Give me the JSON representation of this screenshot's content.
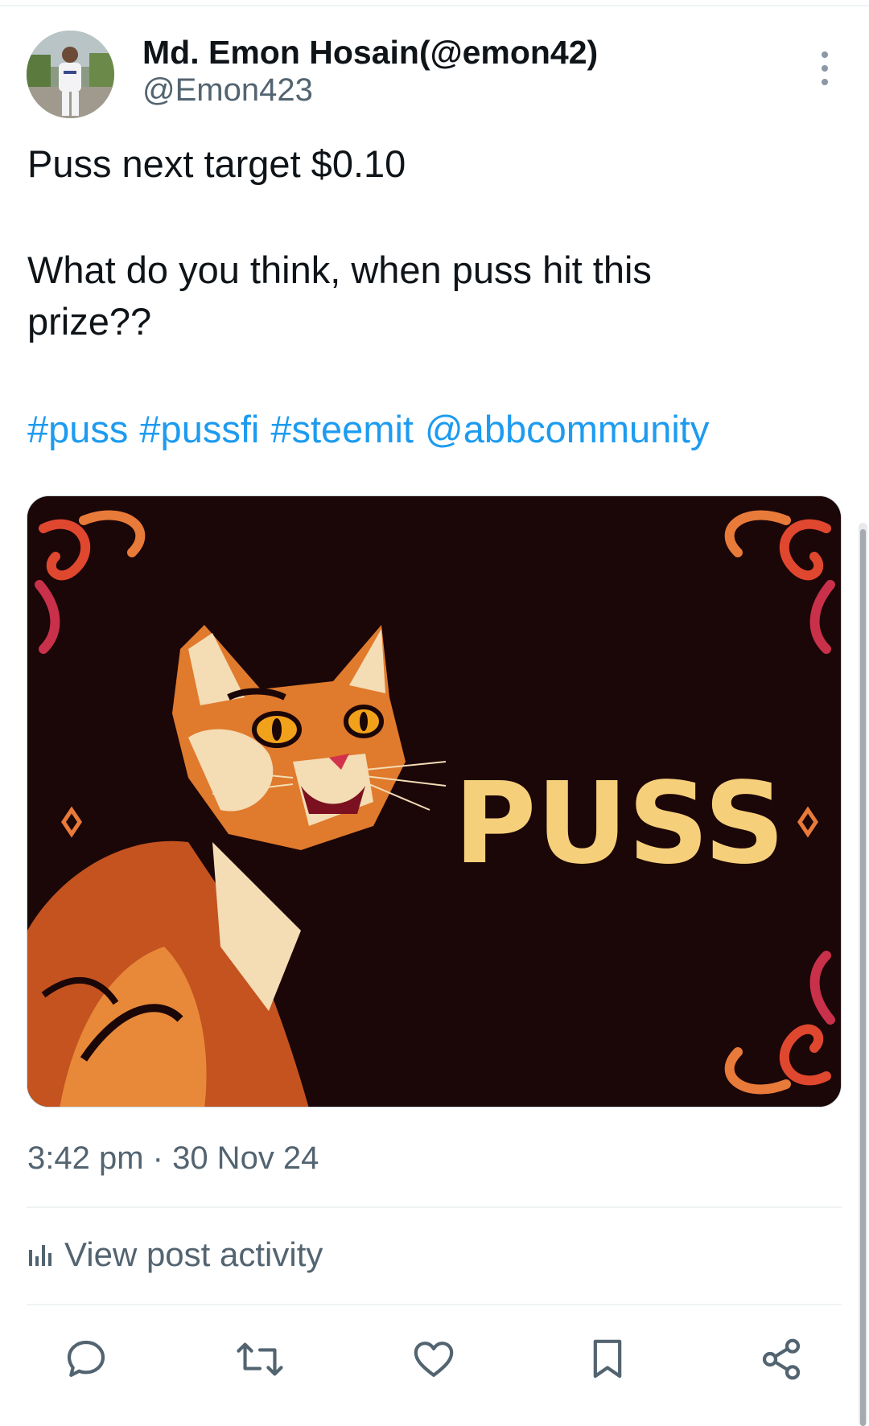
{
  "author": {
    "display_name": "Md. Emon Hosain(@emon42)",
    "handle": "@Emon423"
  },
  "post": {
    "line1": "Puss next target $0.10",
    "line2": "What do you think, when puss hit this",
    "line3": "prize??",
    "tags": [
      "#puss",
      "#pussfi",
      "#steemit",
      "@abbcommunity"
    ],
    "image_text": "PUSS",
    "timestamp": "3:42 pm · 30 Nov 24"
  },
  "activity": {
    "label": "View post activity",
    "icon": "analytics-icon"
  },
  "actions": [
    "reply-icon",
    "repost-icon",
    "like-icon",
    "bookmark-icon",
    "share-icon"
  ],
  "colors": {
    "link": "#1d9bf0",
    "secondary_text": "#536471",
    "image_background": "#1b0608",
    "image_title": "#f6cf7a"
  }
}
